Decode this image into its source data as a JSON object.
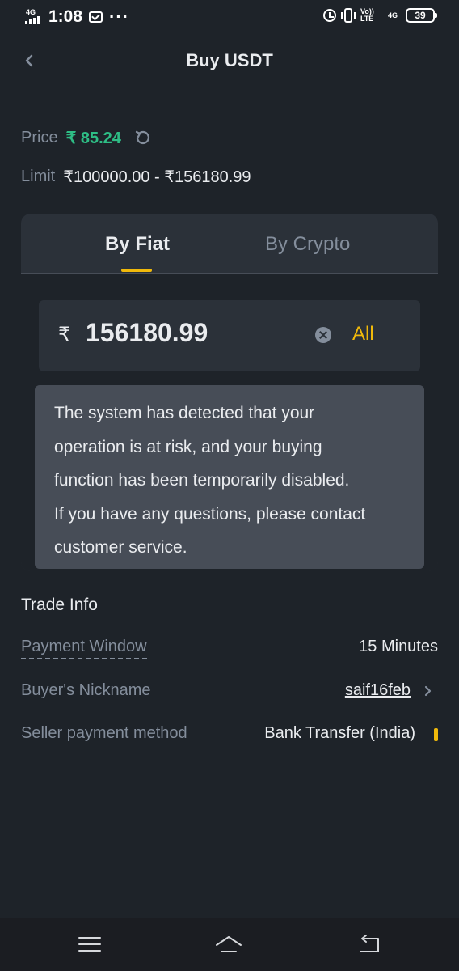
{
  "status_bar": {
    "network": "4G",
    "time": "1:08",
    "more": "···",
    "volte": "Vo)) LTE",
    "network_right": "4G",
    "battery": "39"
  },
  "header": {
    "title": "Buy USDT"
  },
  "price": {
    "label": "Price",
    "value": "₹ 85.24"
  },
  "limit": {
    "label": "Limit",
    "value": "₹100000.00 - ₹156180.99"
  },
  "tabs": [
    {
      "label": "By Fiat",
      "active": true
    },
    {
      "label": "By Crypto",
      "active": false
    }
  ],
  "amount": {
    "currency_symbol": "₹",
    "value": "156180.99",
    "all_label": "All"
  },
  "warning": {
    "lines": [
      "The system has detected that your",
      "operation is at risk, and your buying",
      "function has been temporarily disabled.",
      "If you have any questions, please contact",
      "customer service."
    ]
  },
  "trade_info": {
    "title": "Trade Info",
    "rows": [
      {
        "label": "Payment Window",
        "value": "15 Minutes"
      },
      {
        "label": "Buyer's Nickname",
        "value": "saif16feb"
      },
      {
        "label": "Seller payment method",
        "value": "Bank Transfer (India)"
      }
    ]
  },
  "colors": {
    "background": "#1e2329",
    "card": "#2b3139",
    "accent_yellow": "#f0b90b",
    "price_green": "#2ebd85",
    "muted_text": "#848e9c"
  },
  "icons": {
    "back": "chevron-left-icon",
    "refresh": "refresh-icon",
    "clear": "clear-circle-icon",
    "nav_menu": "menu-icon",
    "nav_home": "home-icon",
    "nav_back": "back-arrow-icon"
  }
}
